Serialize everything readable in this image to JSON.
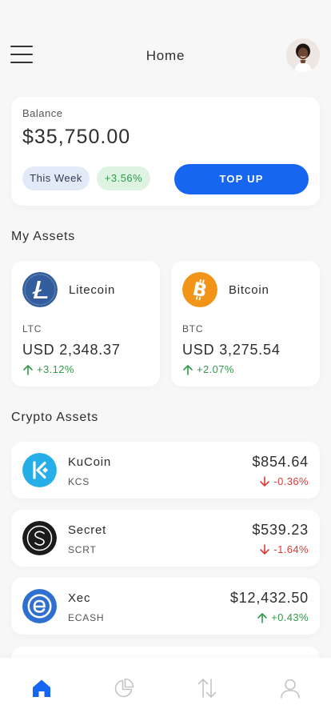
{
  "header": {
    "title": "Home"
  },
  "balance": {
    "label": "Balance",
    "value": "$35,750.00",
    "period": "This Week",
    "change": "+3.56%",
    "topup_label": "TOP UP"
  },
  "my_assets": {
    "title": "My Assets",
    "items": [
      {
        "name": "Litecoin",
        "symbol": "LTC",
        "value": "USD 2,348.37",
        "change": "+3.12%",
        "icon": "litecoin-icon"
      },
      {
        "name": "Bitcoin",
        "symbol": "BTC",
        "value": "USD 3,275.54",
        "change": "+2.07%",
        "icon": "bitcoin-icon"
      }
    ]
  },
  "crypto_assets": {
    "title": "Crypto Assets",
    "items": [
      {
        "name": "KuCoin",
        "symbol": "KCS",
        "price": "$854.64",
        "change": "-0.36%",
        "direction": "down",
        "icon": "kucoin-icon"
      },
      {
        "name": "Secret",
        "symbol": "SCRT",
        "price": "$539.23",
        "change": "-1.64%",
        "direction": "down",
        "icon": "secret-icon"
      },
      {
        "name": "Xec",
        "symbol": "ECASH",
        "price": "$12,432.50",
        "change": "+0.43%",
        "direction": "up",
        "icon": "ecash-icon"
      }
    ]
  },
  "nav": {
    "items": [
      {
        "icon": "home-icon",
        "active": true
      },
      {
        "icon": "pie-chart-icon",
        "active": false
      },
      {
        "icon": "transfer-arrows-icon",
        "active": false
      },
      {
        "icon": "profile-icon",
        "active": false
      }
    ]
  },
  "colors": {
    "accent": "#1766f2",
    "positive": "#2f9a4a",
    "negative": "#d93a3a",
    "background": "#f7f7f7"
  }
}
